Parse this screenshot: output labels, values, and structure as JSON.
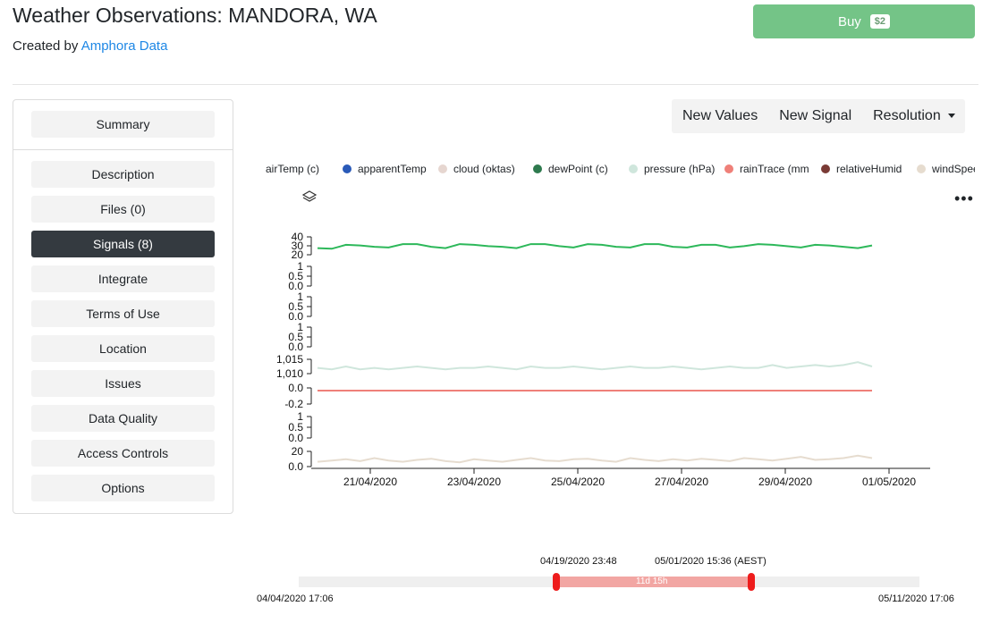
{
  "header": {
    "title": "Weather Observations: MANDORA, WA",
    "created_by": "Created by",
    "author": "Amphora Data",
    "buy_label": "Buy",
    "price": "$2"
  },
  "sidebar": {
    "items": [
      {
        "label": "Summary"
      },
      {
        "label": "Description"
      },
      {
        "label": "Files (0)"
      },
      {
        "label": "Signals (8)",
        "active": true
      },
      {
        "label": "Integrate"
      },
      {
        "label": "Terms of Use"
      },
      {
        "label": "Location"
      },
      {
        "label": "Issues"
      },
      {
        "label": "Data Quality"
      },
      {
        "label": "Access Controls"
      },
      {
        "label": "Options"
      }
    ]
  },
  "toolbar": {
    "new_values": "New Values",
    "new_signal": "New Signal",
    "resolution": "Resolution"
  },
  "legend": [
    {
      "label": "airTemp (c)",
      "color": "#2db85a"
    },
    {
      "label": "apparentTemp",
      "color": "#2a5ab8"
    },
    {
      "label": "cloud (oktas)",
      "color": "#e6d6d0"
    },
    {
      "label": "dewPoint (c)",
      "color": "#2e7a4e"
    },
    {
      "label": "pressure (hPa)",
      "color": "#cfe6dc"
    },
    {
      "label": "rainTrace (mm",
      "color": "#ef8079"
    },
    {
      "label": "relativeHumid",
      "color": "#7a3b35"
    },
    {
      "label": "windSpeed",
      "color": "#e6dccf"
    }
  ],
  "chart_data": {
    "type": "line",
    "x_ticks": [
      "21/04/2020",
      "23/04/2020",
      "25/04/2020",
      "27/04/2020",
      "29/04/2020",
      "01/05/2020"
    ],
    "panels": [
      {
        "series": "airTemp (c)",
        "ticks": [
          "40",
          "30",
          "20"
        ],
        "color": "#2db85a",
        "values": [
          25,
          24,
          30,
          29,
          27,
          26,
          31,
          31,
          27,
          25,
          31,
          30,
          28,
          27,
          25,
          31,
          31,
          28,
          26,
          31,
          30,
          27,
          26,
          31,
          31,
          27,
          26,
          30,
          30,
          26,
          28,
          31,
          30,
          28,
          26,
          30,
          29,
          27,
          25,
          29
        ]
      },
      {
        "series": "apparentTemp",
        "ticks": [
          "1",
          "0.5",
          "0.0"
        ],
        "values": []
      },
      {
        "series": "cloud (oktas)",
        "ticks": [
          "1",
          "0.5",
          "0.0"
        ],
        "values": []
      },
      {
        "series": "dewPoint (c)",
        "ticks": [
          "1",
          "0.5",
          "0.0"
        ],
        "values": []
      },
      {
        "series": "pressure (hPa)",
        "ticks": [
          "1,015",
          "1,010"
        ],
        "color": "#cfe6dc",
        "values": [
          1012,
          1011,
          1013,
          1011,
          1012,
          1011,
          1012,
          1013,
          1012,
          1011,
          1012,
          1012,
          1013,
          1012,
          1011,
          1013,
          1012,
          1012,
          1013,
          1012,
          1011,
          1012,
          1013,
          1012,
          1012,
          1013,
          1012,
          1011,
          1012,
          1013,
          1012,
          1012,
          1014,
          1012,
          1013,
          1014,
          1013,
          1014,
          1016,
          1013
        ]
      },
      {
        "series": "rainTrace (mm",
        "ticks": [
          "0.0",
          "-0.2"
        ],
        "color": "#ef8079",
        "values": [
          0,
          0,
          0,
          0,
          0,
          0,
          0,
          0,
          0,
          0,
          0,
          0,
          0,
          0,
          0,
          0,
          0,
          0,
          0,
          0,
          0,
          0,
          0,
          0,
          0,
          0,
          0,
          0,
          0,
          0,
          0,
          0,
          0,
          0,
          0,
          0,
          0,
          0,
          0,
          0
        ]
      },
      {
        "series": "relativeHumid",
        "ticks": [
          "1",
          "0.5",
          "0.0"
        ],
        "values": []
      },
      {
        "series": "windSpeed",
        "ticks": [
          "20",
          "0.0"
        ],
        "color": "#e6dccf",
        "values": [
          8,
          10,
          12,
          9,
          14,
          10,
          8,
          11,
          13,
          9,
          7,
          12,
          10,
          8,
          11,
          14,
          10,
          9,
          12,
          13,
          10,
          8,
          14,
          11,
          9,
          12,
          10,
          13,
          11,
          9,
          14,
          12,
          10,
          13,
          16,
          11,
          12,
          14,
          18,
          14
        ]
      }
    ]
  },
  "range": {
    "start_full": "04/04/2020 17:06",
    "end_full": "05/11/2020 17:06",
    "sel_start": "04/19/2020 23:48",
    "sel_end": "05/01/2020 15:36 (AEST)",
    "span": "11d 15h"
  }
}
